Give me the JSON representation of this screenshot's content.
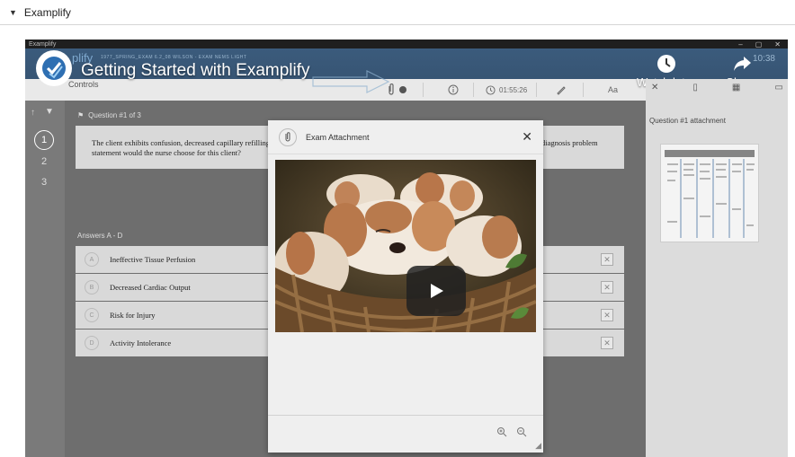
{
  "disclosure": {
    "label": "Examplify"
  },
  "window": {
    "titlebar_label": "Examplify",
    "controls": [
      "–",
      "▢",
      "✕"
    ]
  },
  "app": {
    "brand": "plify",
    "brand_sub": "1977_SPRING_EXAM 6.2_08 WILSON - EXAM NEMS LIGHT",
    "time_right": "10:38",
    "controls_label": "Controls",
    "timer": "01:55:26",
    "font_label": "Aa"
  },
  "video": {
    "title": "Getting Started with Examplify",
    "watch_later": "Watch later",
    "share": "Share"
  },
  "question_nav": [
    "1",
    "2",
    "3"
  ],
  "question": {
    "header": "Question #1 of 3",
    "text": "The client exhibits confusion, decreased capillary refilling",
    "text_line2": "statement would the nurse choose for this client?",
    "text_tail": "diagnosis problem"
  },
  "answers": {
    "label": "Answers A - D",
    "items": [
      {
        "letter": "A",
        "text": "Ineffective Tissue Perfusion"
      },
      {
        "letter": "B",
        "text": "Decreased Cardiac Output"
      },
      {
        "letter": "C",
        "text": "Risk for Injury"
      },
      {
        "letter": "D",
        "text": "Activity Intolerance"
      }
    ]
  },
  "attachment_panel": {
    "title": "Question #1 attachment"
  },
  "modal": {
    "title": "Exam Attachment",
    "close": "✕"
  },
  "colors": {
    "header": "#3b5b7c",
    "panel": "#dcdcdc",
    "overlay": "#6e6e6e"
  }
}
